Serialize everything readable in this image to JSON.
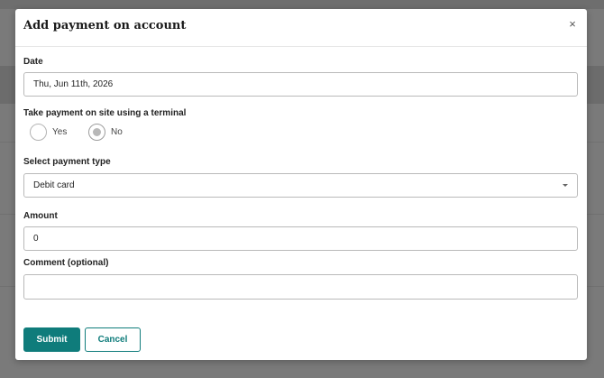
{
  "modal": {
    "title": "Add payment on account",
    "close_symbol": "×"
  },
  "date": {
    "label": "Date",
    "value": "Thu, Jun 11th, 2026"
  },
  "terminal": {
    "label": "Take payment on site using a terminal",
    "options": [
      {
        "label": "Yes",
        "checked": false
      },
      {
        "label": "No",
        "checked": true
      }
    ]
  },
  "payment_type": {
    "label": "Select payment type",
    "selected": "Debit card"
  },
  "amount": {
    "label": "Amount",
    "value": "0"
  },
  "comment": {
    "label": "Comment (optional)",
    "value": ""
  },
  "actions": {
    "submit_label": "Submit",
    "cancel_label": "Cancel"
  },
  "colors": {
    "accent": "#0f7c7b",
    "overlay": "#7a7a7a"
  }
}
